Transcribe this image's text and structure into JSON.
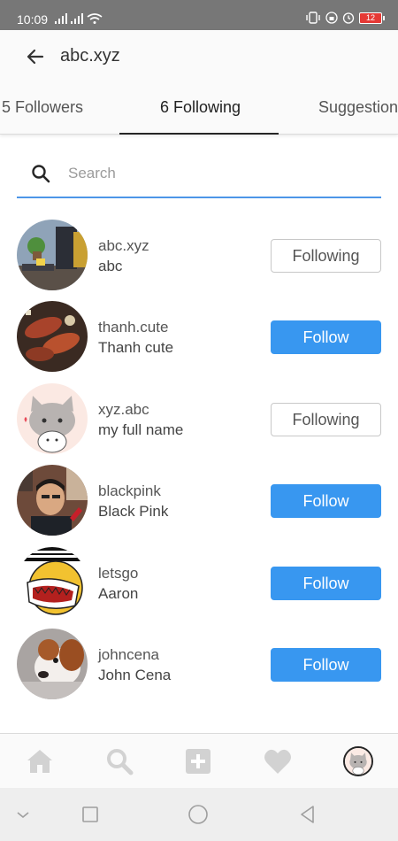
{
  "status_bar": {
    "time": "10:09",
    "battery": "12"
  },
  "header": {
    "title": "abc.xyz"
  },
  "tabs": [
    {
      "label": "5 Followers"
    },
    {
      "label": "6 Following"
    },
    {
      "label": "Suggestion"
    }
  ],
  "search": {
    "placeholder": "Search",
    "value": ""
  },
  "users": [
    {
      "username": "abc.xyz",
      "fullname": "abc",
      "button": "Following"
    },
    {
      "username": "thanh.cute",
      "fullname": "Thanh cute",
      "button": "Follow"
    },
    {
      "username": "xyz.abc",
      "fullname": "my full name",
      "button": "Following"
    },
    {
      "username": "blackpink",
      "fullname": "Black Pink",
      "button": "Follow"
    },
    {
      "username": "letsgo",
      "fullname": "Aaron",
      "button": "Follow"
    },
    {
      "username": "johncena",
      "fullname": "John Cena",
      "button": "Follow"
    }
  ],
  "colors": {
    "accent": "#3897f0",
    "search_underline": "#4d96e8",
    "status_bar": "#777777"
  },
  "bottom_nav": {
    "icons": [
      "home-icon",
      "search-icon",
      "add-icon",
      "heart-icon",
      "profile-avatar"
    ]
  },
  "android_nav": {
    "icons": [
      "chevron-down-icon",
      "recents-icon",
      "home-circle-icon",
      "back-triangle-icon"
    ]
  }
}
